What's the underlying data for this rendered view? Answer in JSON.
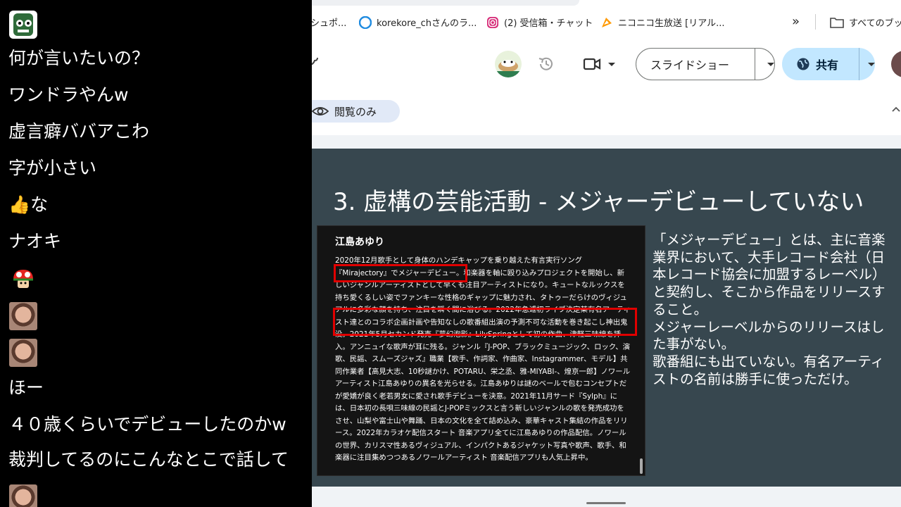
{
  "chat": {
    "messages": [
      "何が言いたいの？",
      "ワンドラやんw",
      "虚言癖ババアこわ",
      "字が小さい",
      "な",
      "ナオキ",
      "ほー",
      "４０歳くらいでデビューしたのかw",
      "裁判してるのにこんなとこで話して"
    ]
  },
  "bookmarks": {
    "items": [
      {
        "label": "シュポ...",
        "icon": "bookmark-icon",
        "color": "#ffffff"
      },
      {
        "label": "korekore_chさんのラ...",
        "icon": "twitcasting-icon",
        "color": "#1f8be0"
      },
      {
        "label": "(2) 受信箱・チャット",
        "icon": "instagram-icon",
        "color": "#d62976"
      },
      {
        "label": "ニコニコ生放送 [リアル...",
        "icon": "niconico-icon",
        "color": "#ff9900"
      },
      {
        "label": "すべてのブック",
        "icon": "folder-icon",
        "color": "#444444"
      }
    ],
    "overflow": "»"
  },
  "toolbar": {
    "slideshow_label": "スライドショー",
    "share_label": "共有"
  },
  "viewonly_label": "閲覧のみ",
  "slide": {
    "title": "3. 虚構の芸能活動 - メジャーデビューしていない",
    "card": {
      "name": "江島あゆり",
      "body": "2020年12月歌手として身体のハンデキャップを乗り越えた有言実行ソング『Mirajectory』でメジャーデビュー。和楽器を軸に殴り込みプロジェクトを開始し、新しいジャンルアーティストとして早くも注目アーティストになり。キュートなルックスを持ち愛くるしい姿でファンキーな性格のギャップに魅力され、タトゥーだらけのヴィジュアルに多彩な顔を持ち、注目を瞬く間に浴びる。2022年急遽初ライブ決定某有名アーティスト達とのコラボ企画計画や告知なしの歌番組出演の予測不可な活動を巻き起こし神出鬼没。2021年5月セカンド発売『夢幻泡影』LilySpringとして初の作曲、津軽三味線を挿入。アンニュイな歌声が耳に残る。ジャンル『J-POP、ブラックミュージック、ロック、演歌、民謡、スムーズジャズ』職業【歌手、作詞家、作曲家、Instagrammer、モデル】共同作業者【高見大志、10秒謎かけ、POTARU、栄之丞、雅-MIYABI-、煌京一郎】ノワールアーティスト江島あゆりの異名を光らせる。江島あゆりは謎のベールで包むコンセプトだが愛嬌が良く老若男女に愛され歌手デビューを決意。2021年11月サード『Sylph』には、日本初の長唄三味線の民謡とJ-POPミックスと言う新しいジャンルの歌を発売成功をさせ、山梨や富士山や舞踊、日本の文化を全て詰め込み、豪華キャスト集結の作品をリリース。2022年カラオケ配信スタート 音楽アプリ全てに江島あゆりの作品配信。ノワールの世界、カリスマ性あるヴィジュアル、インパクトあるジャケット写真や歌声、歌手、和楽器に注目集めつつあるノワールアーティスト 音楽配信アプリも人気上昇中。"
    },
    "text": "「メジャーデビュー」とは、主に音楽業界において、大手レコード会社（日本レコード協会に加盟するレーベル）と契約し、そこから作品をリリースすること。\nメジャーレーベルからのリリースはした事がない。\n歌番組にも出ていない。有名アーティストの名前は勝手に使っただけ。"
  },
  "colors": {
    "slide_bg": "#37474f",
    "highlight": "#e00000",
    "share_bg": "#c2e7ff",
    "viewonly_bg": "#e1e9f7"
  }
}
